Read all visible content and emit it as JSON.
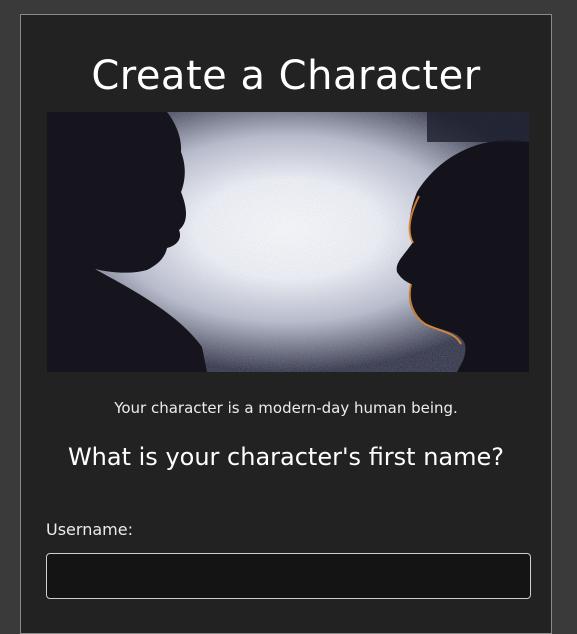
{
  "form": {
    "title": "Create a Character",
    "image_alt": "Silhouettes of two people facing each other",
    "caption": "Your character is a modern-day human being.",
    "question": "What is your character's first name?",
    "username_label": "Username:",
    "username_value": "",
    "username_placeholder": ""
  }
}
